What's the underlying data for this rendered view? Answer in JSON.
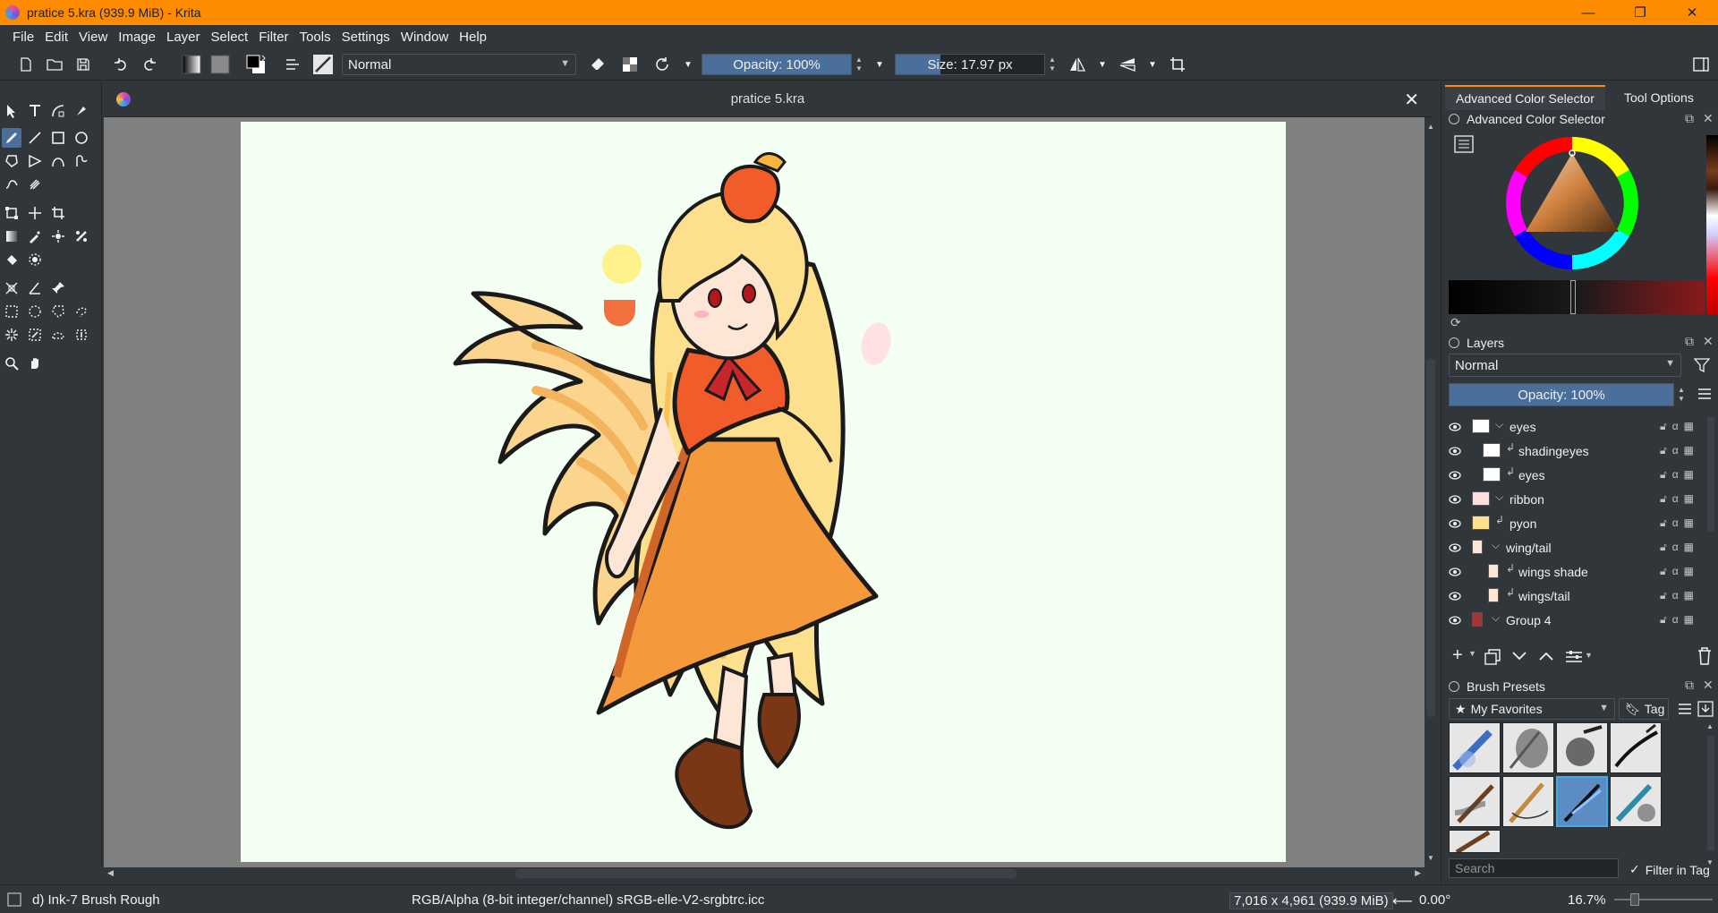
{
  "window": {
    "title": "pratice 5.kra (939.9 MiB)  - Krita",
    "minimize": "—",
    "maximize": "❐",
    "close": "✕"
  },
  "menu": [
    "File",
    "Edit",
    "View",
    "Image",
    "Layer",
    "Select",
    "Filter",
    "Tools",
    "Settings",
    "Window",
    "Help"
  ],
  "toolbar": {
    "blend_mode": "Normal",
    "opacity": "Opacity: 100%",
    "opacity_value": 100,
    "size": "Size: 17.97 px",
    "size_fill": 0.3
  },
  "document": {
    "tab_title": "pratice 5.kra",
    "close": "✕"
  },
  "docker": {
    "tabs": [
      "Advanced Color Selector",
      "Tool Options"
    ],
    "color_selector_title": "Advanced Color Selector",
    "layers_title": "Layers",
    "layer_blend": "Normal",
    "layer_opacity": "Opacity:  100%",
    "layers": [
      {
        "name": "eyes",
        "kind": "group"
      },
      {
        "name": "shadingeyes",
        "kind": "clone"
      },
      {
        "name": "eyes",
        "kind": "clone"
      },
      {
        "name": "ribbon",
        "kind": "group"
      },
      {
        "name": "pyon",
        "kind": "clone"
      },
      {
        "name": "wing/tail",
        "kind": "group"
      },
      {
        "name": "wings shade",
        "kind": "clone"
      },
      {
        "name": "wings/tail",
        "kind": "clone"
      },
      {
        "name": "Group 4",
        "kind": "group"
      }
    ],
    "brush_presets_title": "Brush Presets",
    "brush_tag": "My Favorites",
    "tag_label": "Tag",
    "search_placeholder": "Search",
    "filter_in_tag": "Filter in Tag"
  },
  "status": {
    "brush": "d) Ink-7 Brush Rough",
    "color_space": "RGB/Alpha (8-bit integer/channel)  sRGB-elle-V2-srgbtrc.icc",
    "image_size": "7,016 x 4,961 (939.9 MiB)",
    "rotation": "0.00°",
    "zoom": "16.7%"
  },
  "colors": {
    "accent": "#ff8c00",
    "selection": "#4a6f9a",
    "panel": "#31363b"
  }
}
